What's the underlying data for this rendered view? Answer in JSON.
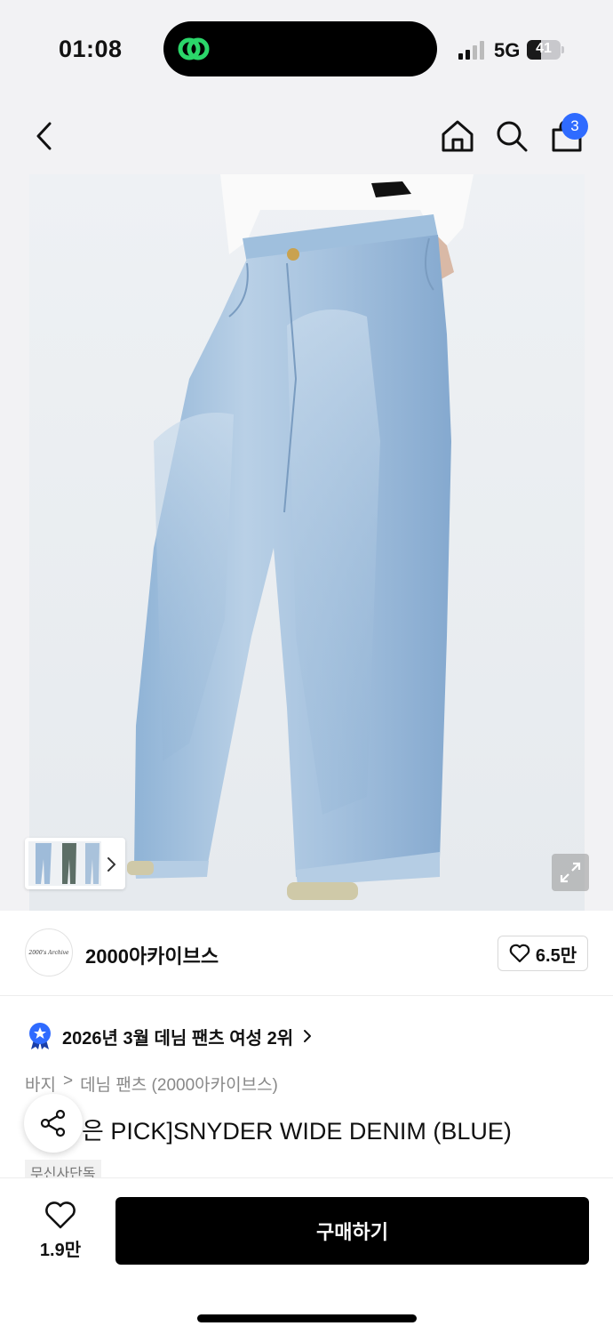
{
  "status_bar": {
    "time": "01:08",
    "network": "5G",
    "battery": "41",
    "battery_level": 0.41
  },
  "nav": {
    "back_icon": "chevron-left-icon",
    "home_icon": "home-icon",
    "search_icon": "search-icon",
    "cart_icon": "shopping-bag-icon",
    "cart_count": "3",
    "badge_color": "#2f6bff"
  },
  "product": {
    "image_icon": "product-photo",
    "expand_icon": "expand-icon"
  },
  "brand": {
    "logo_text": "2000's Archive",
    "name": "2000아카이브스",
    "like_count": "6.5만"
  },
  "ranking": {
    "text": "2026년 3월 데님 팬츠 여성 2위"
  },
  "breadcrumb": {
    "category": "바지",
    "separator": ">",
    "subcategory": "데님 팬츠 (2000아카이브스)"
  },
  "title": {
    "text": "은 PICK]SNYDER WIDE DENIM (BLUE)"
  },
  "tag": {
    "exclusive": "무신사단독"
  },
  "bottom_bar": {
    "wish_count": "1.9만",
    "buy_label": "구매하기"
  }
}
